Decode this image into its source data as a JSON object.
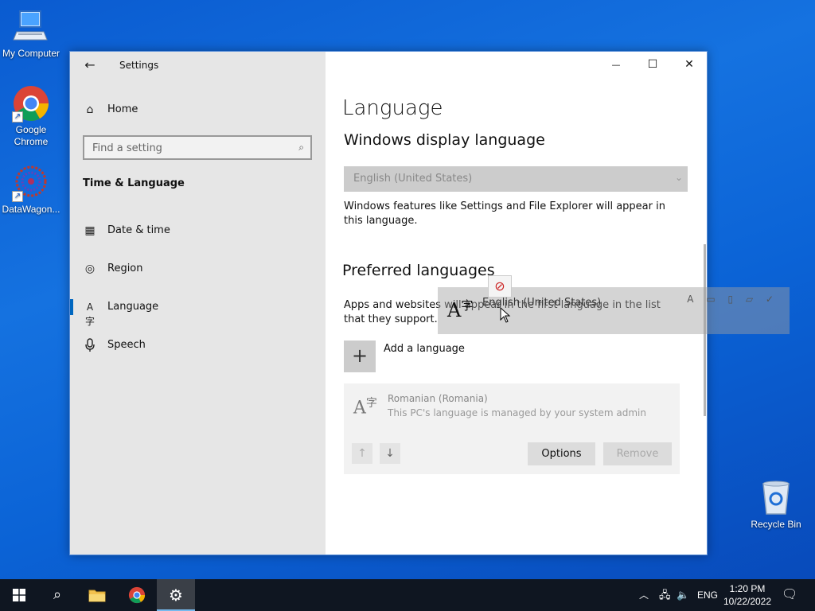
{
  "desktop": {
    "icons": [
      {
        "label": "My Computer"
      },
      {
        "label": "Google Chrome"
      },
      {
        "label": "DataWagon..."
      },
      {
        "label": "Recycle Bin"
      }
    ]
  },
  "window": {
    "title": "Settings",
    "caption": {
      "minimize": "—",
      "maximize": "☐",
      "close": "✕"
    }
  },
  "sidebar": {
    "home_label": "Home",
    "search_placeholder": "Find a setting",
    "section_heading": "Time & Language",
    "items": [
      {
        "label": "Date & time"
      },
      {
        "label": "Region"
      },
      {
        "label": "Language"
      },
      {
        "label": "Speech"
      }
    ]
  },
  "content": {
    "page_title": "Language",
    "display_language": {
      "heading": "Windows display language",
      "selected": "English (United States)",
      "description": "Windows features like Settings and File Explorer will appear in this language."
    },
    "preferred": {
      "heading": "Preferred languages",
      "description": "Apps and websites will appear in the first language in the list that they support.",
      "add_label": "Add a language",
      "languages": [
        {
          "name": "Romanian (Romania)",
          "note": "This PC's language is managed by your system admin"
        }
      ],
      "options_label": "Options",
      "remove_label": "Remove"
    }
  },
  "drag_ghost": {
    "label": "English (United States)"
  },
  "taskbar": {
    "lang": "ENG",
    "time": "1:20 PM",
    "date": "10/22/2022"
  },
  "colors": {
    "accent": "#0067c0",
    "desktop": "#1572e0",
    "taskbar": "#0f1621"
  }
}
